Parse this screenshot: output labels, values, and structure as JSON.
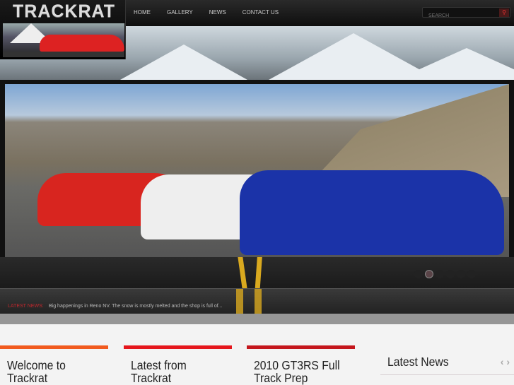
{
  "site": {
    "logo": "TRACKRAT"
  },
  "nav": [
    "HOME",
    "GALLERY",
    "NEWS",
    "CONTACT US"
  ],
  "search": {
    "placeholder": "SEARCH",
    "icon": "search-icon"
  },
  "slider": {
    "slide_count": 6,
    "active_slide": 2
  },
  "ticker": {
    "label": "LATEST NEWS:",
    "text": "Big happenings in Reno NV. The snow is mostly melted and the shop is full of..."
  },
  "columns": [
    {
      "title": "Welcome to Trackrat",
      "color": "#f15a1e"
    },
    {
      "title": "Latest from Trackrat",
      "color": "#e5161c"
    },
    {
      "title": "2010 GT3RS Full Track Prep",
      "color": "#c4161c"
    }
  ],
  "latest_news": {
    "title": "Latest News",
    "prev": "‹",
    "next": "›"
  }
}
